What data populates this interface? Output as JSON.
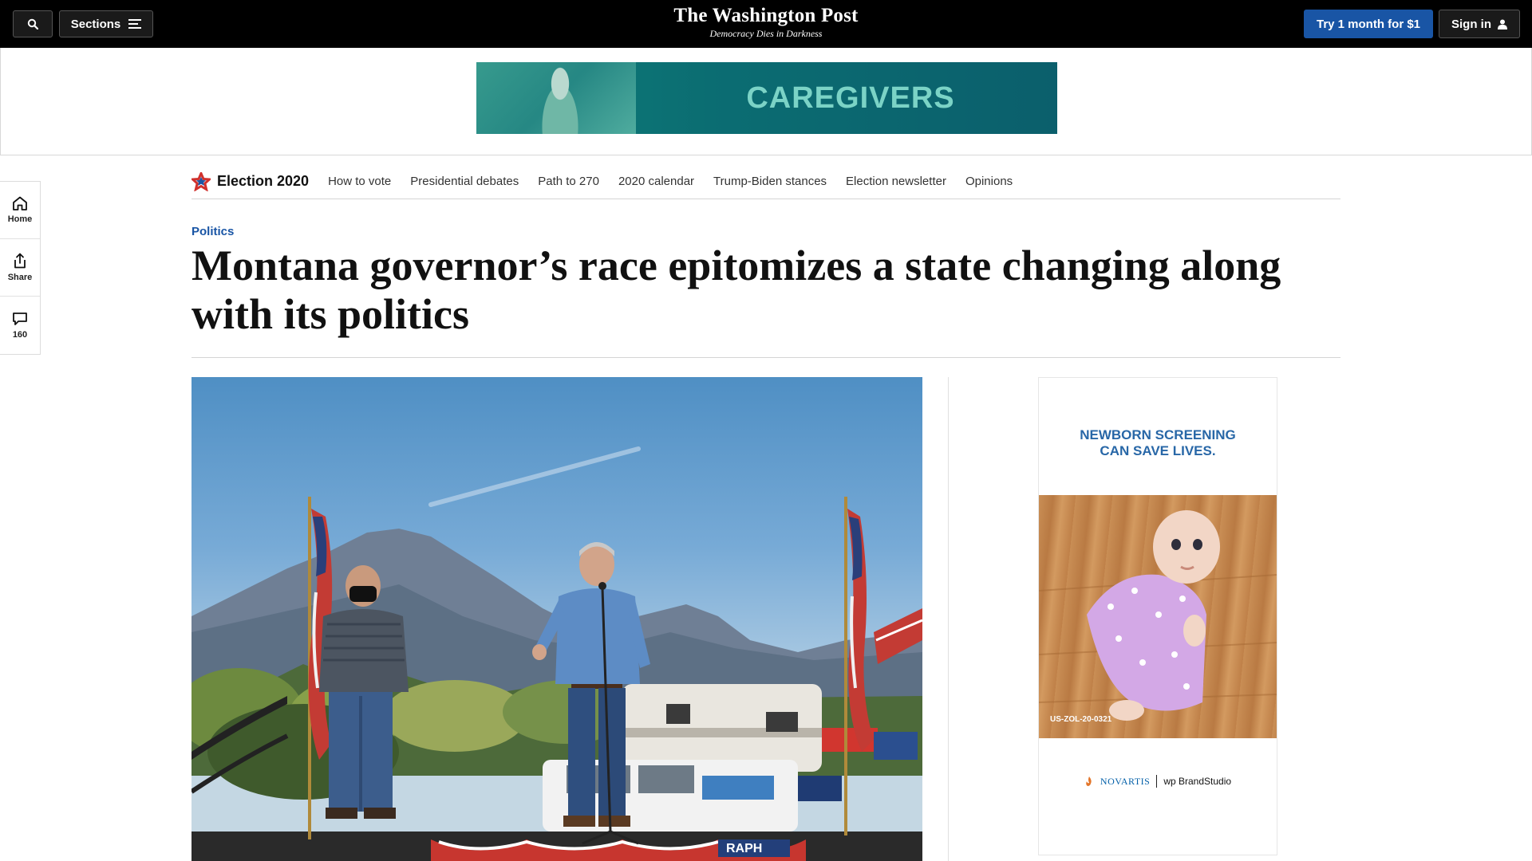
{
  "header": {
    "sections_label": "Sections",
    "logo_name": "The Washington Post",
    "logo_tagline": "Democracy Dies in Darkness",
    "try_label": "Try 1 month for $1",
    "signin_label": "Sign in"
  },
  "top_ad": {
    "text": "CAREGIVERS"
  },
  "rail": {
    "home_label": "Home",
    "share_label": "Share",
    "comments_count": "160"
  },
  "election_nav": {
    "title": "Election 2020",
    "links": [
      "How to vote",
      "Presidential debates",
      "Path to 270",
      "2020 calendar",
      "Trump-Biden stances",
      "Election newsletter",
      "Opinions"
    ]
  },
  "article": {
    "kicker": "Politics",
    "headline": "Montana governor’s race epitomizes a state changing along with its politics"
  },
  "hero_photo": {
    "sign_text": "RAPH"
  },
  "right_ad": {
    "headline_line1": "NEWBORN SCREENING",
    "headline_line2": "CAN SAVE LIVES.",
    "code": "US-ZOL-20-0321",
    "brand_novartis": "NOVARTIS",
    "brand_wp": "wp BrandStudio"
  },
  "colors": {
    "accent_blue": "#1955a5",
    "topbar": "#000000",
    "ad_teal": "#0b6d72"
  }
}
